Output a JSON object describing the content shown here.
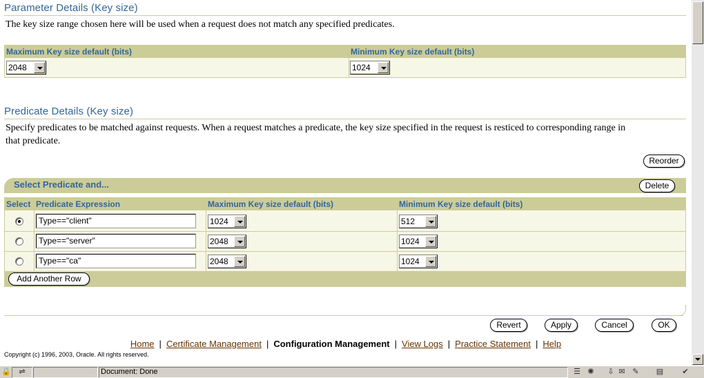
{
  "param": {
    "title": "Parameter Details (Key size)",
    "description": "The key size range chosen here will be used when a request does not match any specified predicates.",
    "max_header": "Maximum Key size default (bits)",
    "min_header": "Minimum Key size default (bits)",
    "max_value": "2048",
    "min_value": "1024"
  },
  "predicate": {
    "title": "Predicate Details (Key size)",
    "description_line1": "Specify predicates to be matched against requests. When a request matches a predicate, the key size specified in the request is resticed to corresponding range in",
    "description_line2": "that predicate.",
    "reorder_label": "Reorder",
    "select_title": "Select Predicate and...",
    "delete_label": "Delete",
    "columns": {
      "select": "Select",
      "expr": "Predicate Expression",
      "max": "Maximum Key size default (bits)",
      "min": "Minimum Key size default (bits)"
    },
    "rows": [
      {
        "selected": true,
        "expr": "Type==\"client\"",
        "max": "1024",
        "min": "512"
      },
      {
        "selected": false,
        "expr": "Type==\"server\"",
        "max": "2048",
        "min": "1024"
      },
      {
        "selected": false,
        "expr": "Type==\"ca\"",
        "max": "2048",
        "min": "1024"
      }
    ],
    "add_row_label": "Add Another Row"
  },
  "actions": {
    "revert": "Revert",
    "apply": "Apply",
    "cancel": "Cancel",
    "ok": "OK"
  },
  "footer": {
    "home": "Home",
    "cert_mgmt": "Certificate Management",
    "config_mgmt": "Configuration Management",
    "view_logs": "View Logs",
    "practice": "Practice Statement",
    "help": "Help",
    "sep": "|",
    "copyright": "Copyright (c) 1996, 2003, Oracle. All rights reserved."
  },
  "status": {
    "text": "Document: Done"
  }
}
